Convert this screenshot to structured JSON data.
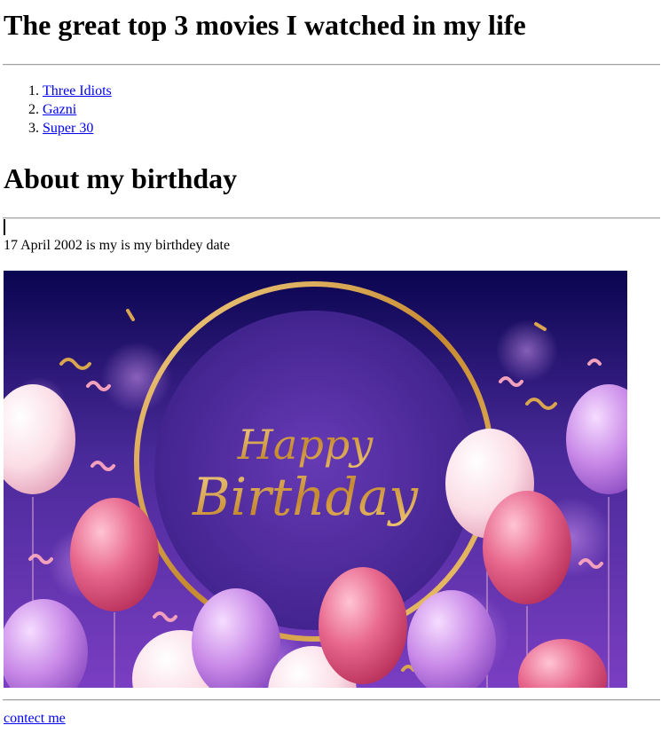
{
  "page": {
    "title": "The great top 3 movies I watched in my life",
    "movies": [
      "Three Idiots",
      "Gazni",
      "Super 30"
    ],
    "birthday_heading": "About my birthday",
    "birthday_text": "17 April 2002 is my is my birthdey date",
    "image": {
      "line1": "Happy",
      "line2": "Birthday",
      "colors": {
        "bg_top": "#0a0550",
        "bg_bottom": "#7a3ec2",
        "gold": "#d6a24a",
        "pink": "#e2557e",
        "white_balloon": "#fbe3ea",
        "lilac": "#c58ae6"
      }
    },
    "contact_label": "contect me",
    "colors": {
      "link": "#0000ee",
      "rule": "#a0a0a0"
    }
  }
}
